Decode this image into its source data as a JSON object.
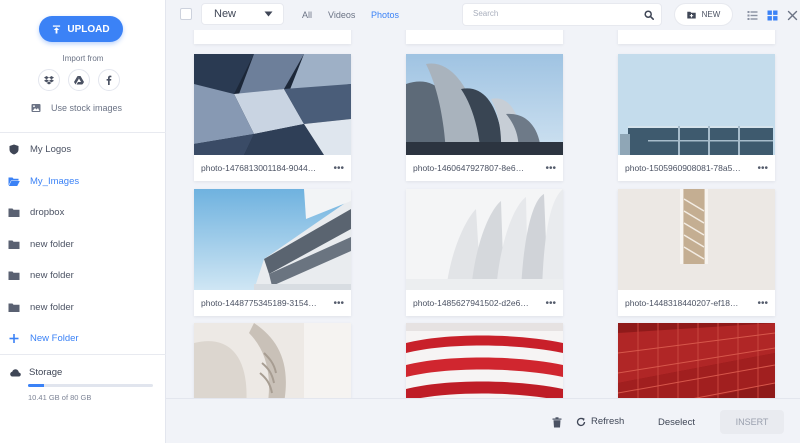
{
  "colors": {
    "accent": "#3b82f6",
    "sidebar_bg": "#ffffff",
    "main_bg": "#f1f3f8"
  },
  "sidebar": {
    "upload_label": "UPLOAD",
    "import_label": "Import from",
    "import_sources": [
      "dropbox-icon",
      "google-drive-icon",
      "facebook-icon"
    ],
    "stock_label": "Use stock images",
    "items": [
      {
        "label": "My Logos",
        "icon": "shield-icon"
      },
      {
        "label": "My_Images",
        "icon": "folder-open-icon",
        "active": true
      },
      {
        "label": "dropbox",
        "icon": "folder-icon"
      },
      {
        "label": "new folder",
        "icon": "folder-icon"
      },
      {
        "label": "new folder",
        "icon": "folder-icon"
      },
      {
        "label": "new folder",
        "icon": "folder-icon"
      }
    ],
    "new_folder_label": "New Folder",
    "storage": {
      "label": "Storage",
      "used_text": "10.41 GB of 80 GB",
      "used_fraction": 0.13
    }
  },
  "toolbar": {
    "sort_value": "New",
    "filters": [
      "All",
      "Videos",
      "Photos"
    ],
    "active_filter": "Photos",
    "search_placeholder": "Search",
    "new_label": "NEW"
  },
  "images": [
    {
      "name": "photo-1476813001184-9044…"
    },
    {
      "name": "photo-1460647927807-8e6…"
    },
    {
      "name": "photo-1505960908081-78a5…"
    },
    {
      "name": "photo-1448775345189-3154…"
    },
    {
      "name": "photo-1485627941502-d2e6…"
    },
    {
      "name": "photo-1448318440207-ef18…"
    },
    {
      "name": ""
    },
    {
      "name": ""
    },
    {
      "name": ""
    }
  ],
  "footer": {
    "refresh_label": "Refresh",
    "deselect_label": "Deselect",
    "insert_label": "INSERT"
  }
}
